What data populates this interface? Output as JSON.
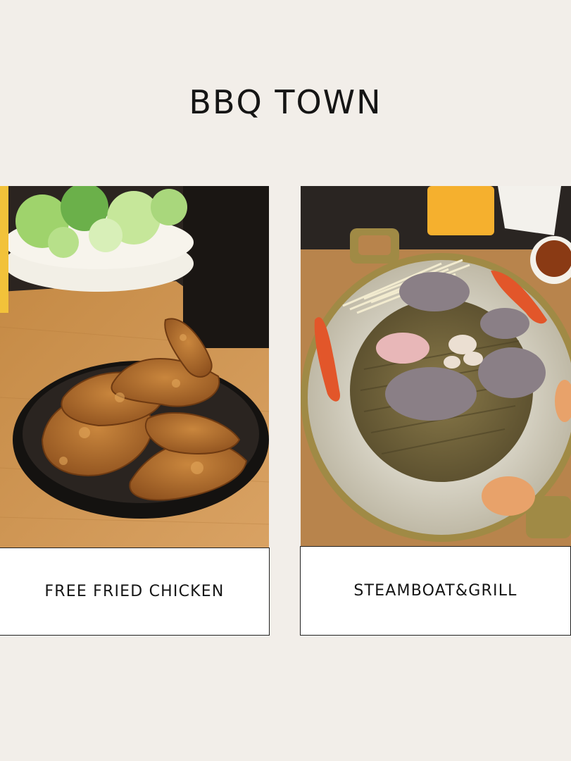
{
  "page": {
    "title": "BBQ TOWN",
    "background_color": "#f2eee9"
  },
  "cards": [
    {
      "caption": "FREE FRIED CHICKEN",
      "photo": "fried-chicken-wings-on-black-plate"
    },
    {
      "caption": "STEAMBOAT&GRILL",
      "photo": "steamboat-grill-pot-with-meat"
    }
  ]
}
